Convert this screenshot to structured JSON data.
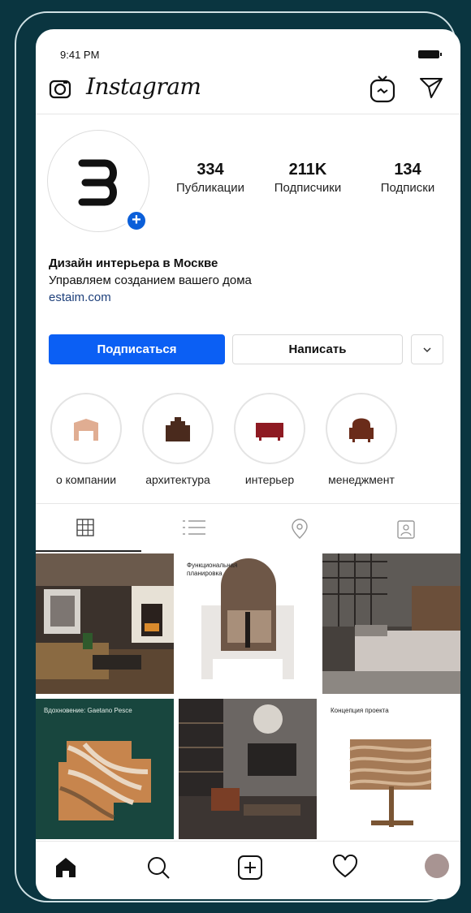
{
  "status_bar": {
    "time": "9:41 PM"
  },
  "header": {
    "logo": "Instagram"
  },
  "profile": {
    "stats": [
      {
        "value": "334",
        "label": "Публикации"
      },
      {
        "value": "211K",
        "label": "Подписчики"
      },
      {
        "value": "134",
        "label": "Подписки"
      }
    ],
    "name": "Дизайн интерьера в Москве",
    "description": "Управляем созданием вашего дома",
    "link": "estaim.com"
  },
  "actions": {
    "follow": "Подписаться",
    "message": "Написать"
  },
  "highlights": [
    {
      "label": "о компании",
      "color": "#e0ad92"
    },
    {
      "label": "архитектура",
      "color": "#4a2a1d"
    },
    {
      "label": "интерьер",
      "color": "#8e1a22"
    },
    {
      "label": "менеджмент",
      "color": "#6a2c1a"
    }
  ],
  "posts": [
    {
      "caption": ""
    },
    {
      "caption": "Функциональная планировка"
    },
    {
      "caption": ""
    },
    {
      "caption": "Вдохновение: Gaetano Pesce"
    },
    {
      "caption": ""
    },
    {
      "caption": "Концепция проекта"
    }
  ],
  "colors": {
    "accent": "#0b5ff4",
    "background": "#0a3540",
    "badge": "#0b5fd9"
  }
}
